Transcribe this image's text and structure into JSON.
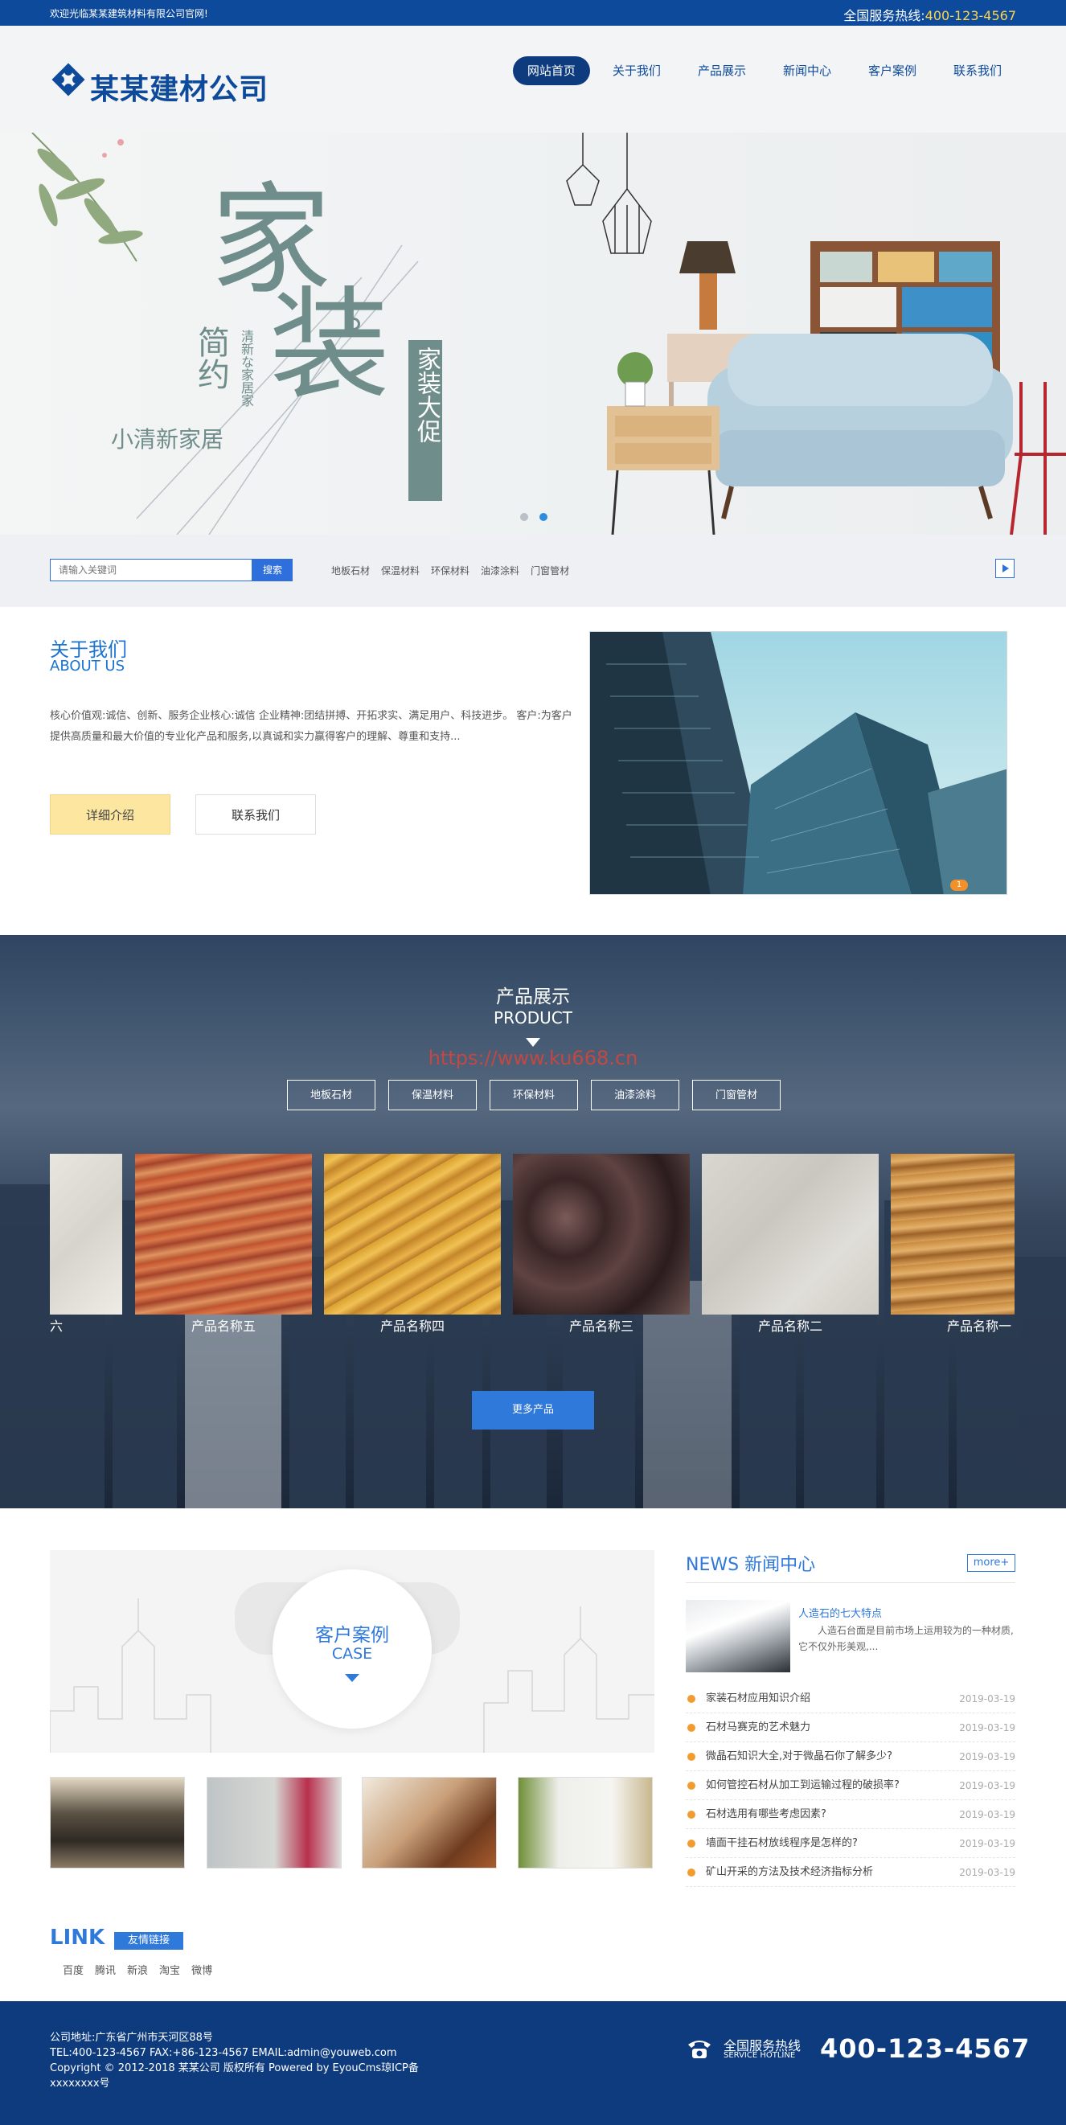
{
  "topbar": {
    "welcome": "欢迎光临某某建筑材料有限公司官网!",
    "hotline_label": "全国服务热线:",
    "hotline_number": "400-123-4567"
  },
  "header": {
    "logo_text": "某某建材公司",
    "nav": [
      "网站首页",
      "关于我们",
      "产品展示",
      "新闻中心",
      "客户案例",
      "联系我们"
    ]
  },
  "banner": {
    "big1": "家",
    "big2": "装",
    "vert1": "简约",
    "vert2": "清新な家居家",
    "tag": "小清新家居",
    "promo": "家装大促"
  },
  "search": {
    "placeholder": "请输入关键词",
    "button": "搜索",
    "hotkeys": [
      "地板石材",
      "保温材料",
      "环保材料",
      "油漆涂料",
      "门窗管材"
    ]
  },
  "about": {
    "title": "关于我们",
    "subtitle": "ABOUT US",
    "text": "核心价值观:诚信、创新、服务企业核心:诚信 企业精神:团结拼搏、开拓求实、满足用户、科技进步。 客户:为客户提供高质量和最大价值的专业化产品和服务,以真诚和实力赢得客户的理解、尊重和支持...",
    "detail_btn": "详细介绍",
    "contact_btn": "联系我们",
    "badge": "1"
  },
  "product": {
    "title": "产品展示",
    "subtitle": "PRODUCT",
    "watermark": "https://www.ku668.cn",
    "categories": [
      "地板石材",
      "保温材料",
      "环保材料",
      "油漆涂料",
      "门窗管材"
    ],
    "items": [
      "六",
      "产品名称五",
      "产品名称四",
      "产品名称三",
      "产品名称二",
      "产品名称一"
    ],
    "more": "更多产品"
  },
  "case": {
    "title": "客户案例",
    "subtitle": "CASE"
  },
  "news": {
    "title": "NEWS 新闻中心",
    "more": "more+",
    "featured_title": "人造石的七大特点",
    "featured_text": "人造石台面是目前市场上运用较为的一种材质,它不仅外形美观,...",
    "items": [
      {
        "title": "家装石材应用知识介绍",
        "date": "2019-03-19"
      },
      {
        "title": "石材马赛克的艺术魅力",
        "date": "2019-03-19"
      },
      {
        "title": "微晶石知识大全,对于微晶石你了解多少?",
        "date": "2019-03-19"
      },
      {
        "title": "如何管控石材从加工到运输过程的破损率?",
        "date": "2019-03-19"
      },
      {
        "title": "石材选用有哪些考虑因素?",
        "date": "2019-03-19"
      },
      {
        "title": "墙面干挂石材放线程序是怎样的?",
        "date": "2019-03-19"
      },
      {
        "title": "矿山开采的方法及技术经济指标分析",
        "date": "2019-03-19"
      }
    ]
  },
  "link": {
    "title": "LINK",
    "tag": "友情链接",
    "items": [
      "百度",
      "腾讯",
      "新浪",
      "淘宝",
      "微博"
    ]
  },
  "footer": {
    "address": "公司地址:广东省广州市天河区88号",
    "contact": "TEL:400-123-4567 FAX:+86-123-4567 EMAIL:admin@youweb.com",
    "copyright": "Copyright © 2012-2018 某某公司 版权所有 Powered by EyouCms琼ICP备",
    "icp": "xxxxxxxx号",
    "hotline_cn": "全国服务热线",
    "hotline_en": "SERVICE HOTLINE",
    "number": "400-123-4567"
  }
}
